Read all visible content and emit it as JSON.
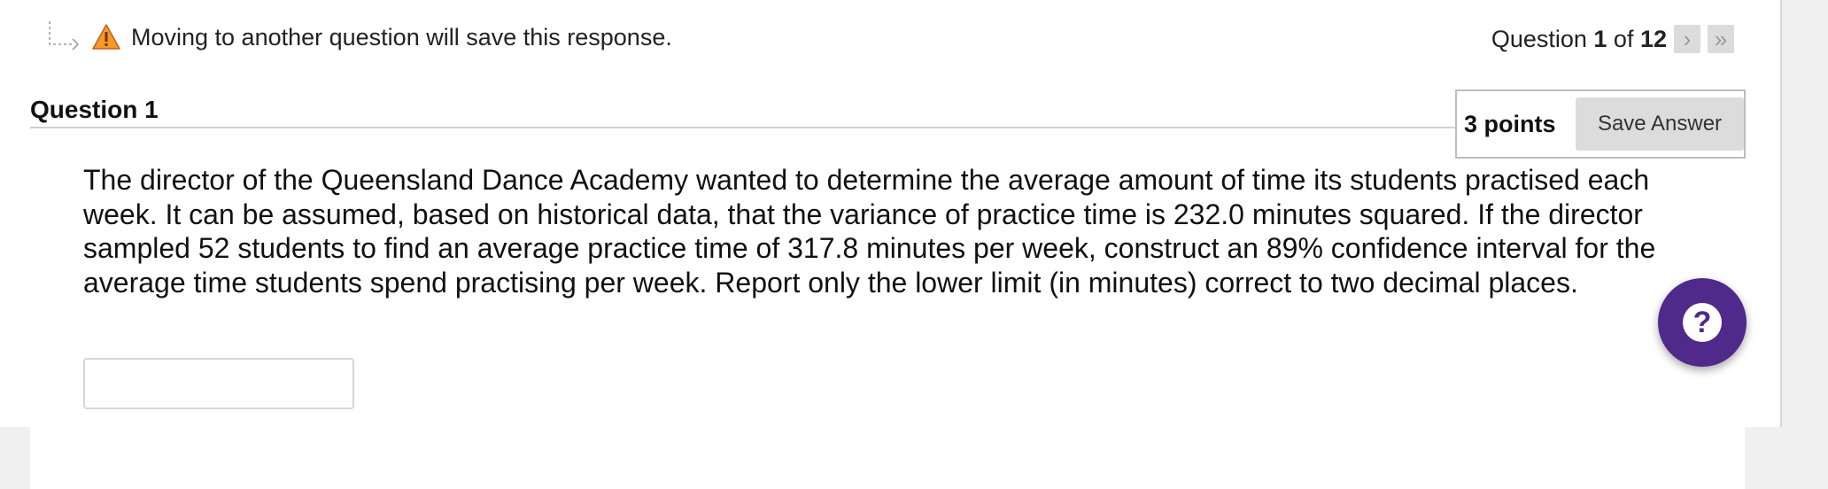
{
  "warning": {
    "text": "Moving to another question will save this response."
  },
  "question_nav": {
    "prefix": "Question ",
    "current": "1",
    "of_label": " of ",
    "total": "12",
    "next_glyph": "›",
    "last_glyph": "»"
  },
  "question": {
    "title": "Question 1",
    "points": "3 points",
    "save_label": "Save Answer",
    "body": "The director of the Queensland Dance Academy wanted to determine the average amount of time its students practised each week. It can be assumed, based on historical data, that the variance of practice time is 232.0 minutes squared. If the director sampled 52 students to find an average practice time of 317.8 minutes per week, construct an 89% confidence interval for the average time students spend practising per week. Report only the lower limit (in minutes) correct to two decimal places.",
    "answer_value": ""
  },
  "help": {
    "glyph": "?"
  },
  "colors": {
    "help_button": "#4f2a8a",
    "warning_icon": "#f39a2b"
  },
  "icons": {
    "warning": "warning-icon",
    "arrow": "return-arrow-icon",
    "help": "help-icon"
  }
}
